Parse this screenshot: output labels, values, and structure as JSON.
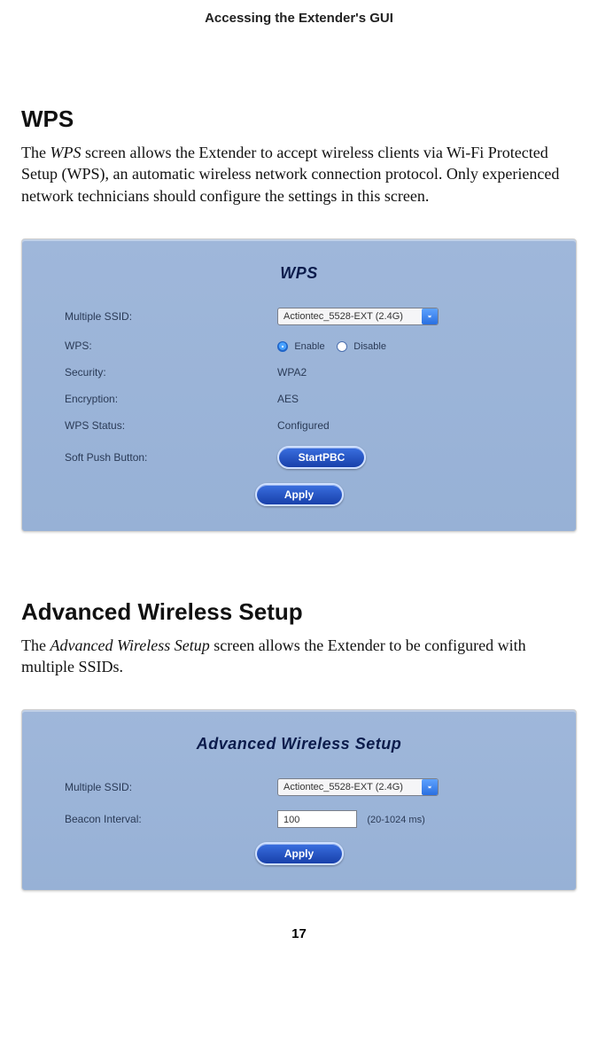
{
  "docHeader": "Accessing the Extender's GUI",
  "pageNumber": "17",
  "section1": {
    "title": "WPS",
    "body_pre": "The ",
    "body_italic": "WPS",
    "body_post": " screen allows the Extender to accept wireless clients via Wi-Fi Protected Setup (WPS), an automatic wireless network connection protocol. Only experienced network technicians should configure the settings in this screen.",
    "panelTitle": "WPS",
    "rows": {
      "multipleSsidLabel": "Multiple SSID:",
      "multipleSsidValue": "Actiontec_5528-EXT (2.4G)",
      "wpsLabel": "WPS:",
      "wpsEnable": "Enable",
      "wpsDisable": "Disable",
      "securityLabel": "Security:",
      "securityValue": "WPA2",
      "encryptionLabel": "Encryption:",
      "encryptionValue": "AES",
      "wpsStatusLabel": "WPS Status:",
      "wpsStatusValue": "Configured",
      "softPushLabel": "Soft Push Button:",
      "startPbc": "StartPBC",
      "apply": "Apply"
    }
  },
  "section2": {
    "title": "Advanced Wireless Setup",
    "body_pre": "The ",
    "body_italic": "Advanced Wireless Setup",
    "body_post": " screen allows the Extender to be configured with multiple SSIDs.",
    "panelTitle": "Advanced Wireless Setup",
    "rows": {
      "multipleSsidLabel": "Multiple SSID:",
      "multipleSsidValue": "Actiontec_5528-EXT (2.4G)",
      "beaconLabel": "Beacon Interval:",
      "beaconValue": "100",
      "beaconHint": "(20-1024 ms)",
      "apply": "Apply"
    }
  }
}
